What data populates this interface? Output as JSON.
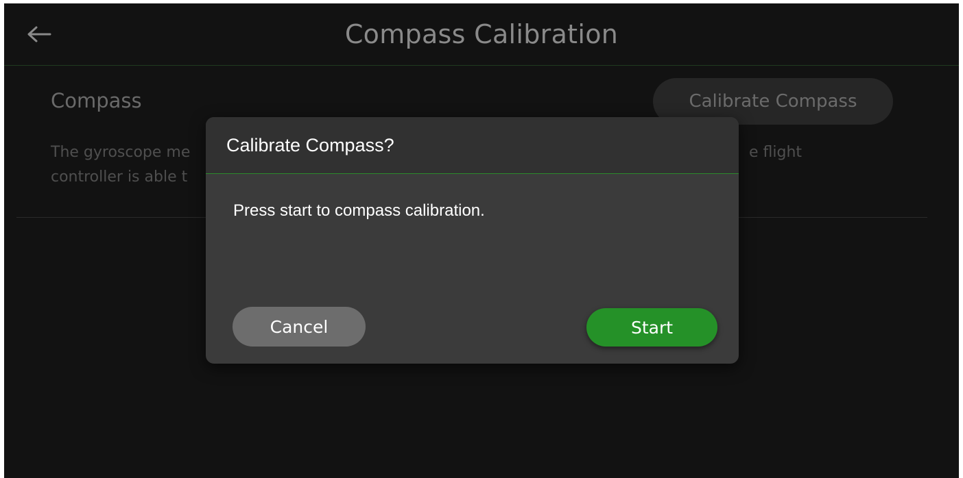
{
  "header": {
    "back_icon": "arrow-left-icon",
    "title": "Compass Calibration"
  },
  "section": {
    "title": "Compass",
    "button_label": "Calibrate Compass",
    "description_line1": "The gyroscope me",
    "description_line1_tail": "e flight",
    "description_line2": "controller is able t"
  },
  "dialog": {
    "title": "Calibrate Compass?",
    "message": "Press start to compass calibration.",
    "cancel_label": "Cancel",
    "start_label": "Start"
  },
  "colors": {
    "background": "#121212",
    "dialog": "#3b3b3b",
    "dialog_header": "#313131",
    "accent_green": "#259128",
    "cancel_gray": "#6d6d6d"
  }
}
